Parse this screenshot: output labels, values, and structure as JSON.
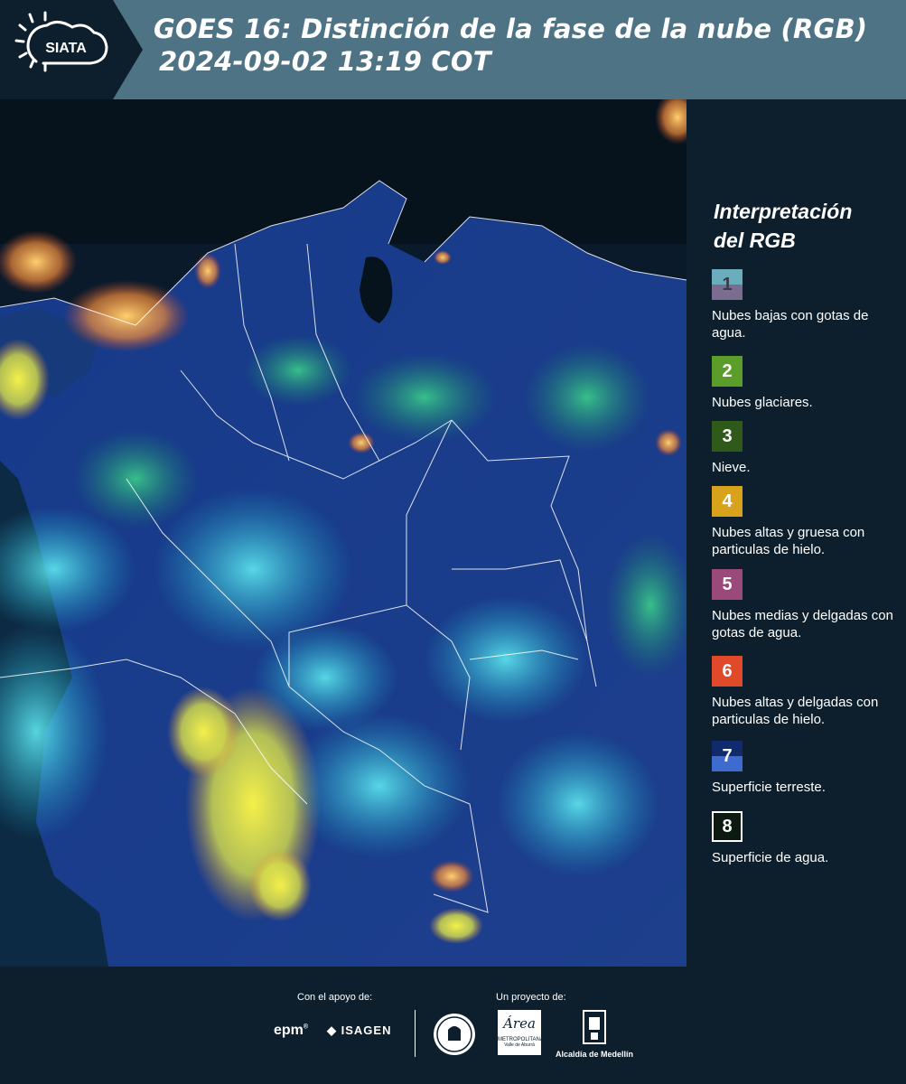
{
  "header": {
    "logo_text": "SIATA",
    "title_line1": "GOES 16: Distinción de la fase de la nube (RGB)",
    "title_line2": "2024-09-02 13:19 COT"
  },
  "map": {
    "description_icon": "satellite-rgb-map"
  },
  "legend": {
    "title_line1": "Interpretación",
    "title_line2": "del RGB",
    "items": [
      {
        "num": "1",
        "label": "Nubes bajas con gotas de agua.",
        "color_top": "#6aaebd",
        "color_bottom": "#7a6d8f"
      },
      {
        "num": "2",
        "label": "Nubes glaciares.",
        "color_top": "#5b9c2a",
        "color_bottom": "#5b9c2a"
      },
      {
        "num": "3",
        "label": "Nieve.",
        "color_top": "#2f5a1a",
        "color_bottom": "#2f5a1a"
      },
      {
        "num": "4",
        "label": "Nubes altas y gruesa con particulas de hielo.",
        "color_top": "#d9a21b",
        "color_bottom": "#d9a21b"
      },
      {
        "num": "5",
        "label": "Nubes medias y delgadas con gotas de agua.",
        "color_top": "#9a4a7a",
        "color_bottom": "#9a4a7a"
      },
      {
        "num": "6",
        "label": "Nubes altas y delgadas con particulas de hielo.",
        "color_top": "#e04a2a",
        "color_bottom": "#e04a2a"
      },
      {
        "num": "7",
        "label": "Superficie terreste.",
        "color_top": "#112a6b",
        "color_bottom": "#3d6bd0"
      },
      {
        "num": "8",
        "label": "Superficie de agua.",
        "color_top": "#0c1a12",
        "color_bottom": "#0c1a12"
      }
    ]
  },
  "footer": {
    "support_label": "Con el apoyo de:",
    "project_label": "Un proyecto de:",
    "epm": "epm",
    "isagen": "ISAGEN",
    "metropolitana_title": "Área",
    "metropolitana_sub1": "METROPOLITANA",
    "metropolitana_sub2": "Valle de Aburrá",
    "alcaldia": "Alcaldía de Medellín"
  }
}
